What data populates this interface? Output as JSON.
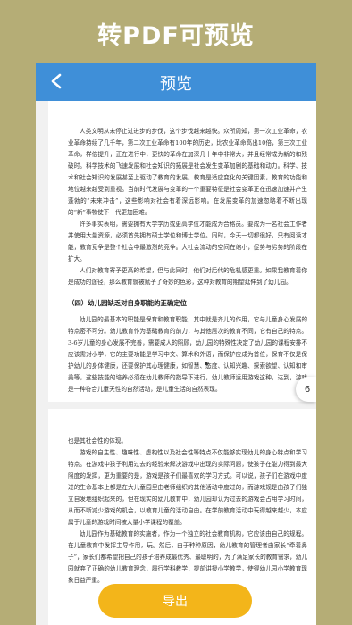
{
  "banner": {
    "title": "转PDF可预览"
  },
  "appbar": {
    "title": "预览"
  },
  "page_indicator": "6",
  "page1": {
    "paragraphs": [
      "人类文明从未停止过进步的步伐，这个步伐越来越快。众所周知，第一次工业革命，农业革命持续了几千年，第二次工业革命有100年的历史，比农业革命高出10倍，第三次工业革命，样倍提升，正在进行中，更快的革命在加深几十年中非常大，并且经常成为新的和残破时。科学技术的飞速发展和社会知识的拓展是社会发生变革加剧的基础和动力。科学、技术和社会知识的发展甚至上驱动了教育的发展。教育是适应变化的关键因素，教育的功能和地位越来越受到重视。当前时代发展与变革的一个重要特征是社会变革正在迅速加速并产生蓬勃的“未来冲击”，这些影响对社会有着深远影响。在发展变革的加速忽略着不断出现的“新”事物使下一代更加困难。",
      "许多事实表明，需要拥有大学学历或更高学位才能成为合格员。要成为一名社会工作者并使用大量资源，必须首先拥有硕士学位和博士学位。同时，今天一切都很好，只有阅读才能，教育竞争是整个社会中最激烈的竞争。大社会流动的空间在缩小，促势与劣势的阶段在扩大。",
      "人们对教育寄予更高的希望，但与此同时，他们对后代的危机感更重。如果我教育着你是成功的途径，那么教育就被赋予了奇妙的色彩，这种对教育的期望延伸到了幼儿园。"
    ],
    "section_heading": "（四）幼儿园缺乏对自身职能的正确定位",
    "paragraphs_after": [
      "幼儿园的最基本的职能是保育和教育职能，其中就是齐儿的作用，它与儿童身心发展的特点密不可分。幼儿教育作为基础教育的前力，与其他层次的教育不同，它有自己的特点。3-6岁儿童的身心发展不完善，需要成人的照顾，幼儿园的特殊性决定了幼儿园的课程安排不应该需对小学，它的主要功能是学习中文、算术和外语，而保护应成为首位，保育不仅是保护幼儿的身体健康，还要保护其心理健康，如智慧、态度、认知兴趣、探索欲望、认知和审美等，这些技能的培养必须在幼儿教师的指导下进行，幼儿教师运用游戏这种，达到，游戏是一种符合儿童天性的自然活动，是儿童生活的自然表现。"
    ]
  },
  "page2": {
    "paragraphs": [
      "也是其社会性的体现。",
      "游戏的自主性、趣味性、虚构性以及社会性等特点不仅能够实现幼儿的身心特点和学习特点。在游戏中孩子利用过去的经验来解决游戏中出现的实际问题，使孩子在能力得到最大限度的发挥，更为重要的是，游戏是孩子们最喜欢的学习方式。可以说，孩子们在游戏中度过的生命基本上都是在大儿童园里由老师组织的其他活动中度过的，而游戏规是由孩子们独立自发地组织起来的，但在现实的幼儿教育中，幼儿园却认为过去的游戏会占用学习时间，从而不断减少游戏的机会，以教育儿童的活动自由。在学前教育活动中玩得越来越少，本应属于儿童的游戏时间被大量小学课程的覆盖。",
      "幼儿园作为基础教育的实施者，作为一个独立的社会教育机构，它应该由自己的规程。在儿童教育中发挥主导作用，玩。然后，由于种种原因，幼儿教育的管理者由家长“牵着鼻子”，家长们都希望把自己的孩子培养成最优秀、最聪明的，为了满足家长的教育需求，幼儿园就弃了正确的幼儿教育理念，履行学科教学，提前讲授小学教学，使得幼儿园小学教育现象日益严重。"
    ]
  },
  "footer": {
    "export_label": "导出"
  },
  "colors": {
    "background": "#b5ad76",
    "appbar": "#3f8fd8",
    "export_button": "#f3b51a"
  },
  "icons": {
    "back": "chevron-left-icon"
  }
}
